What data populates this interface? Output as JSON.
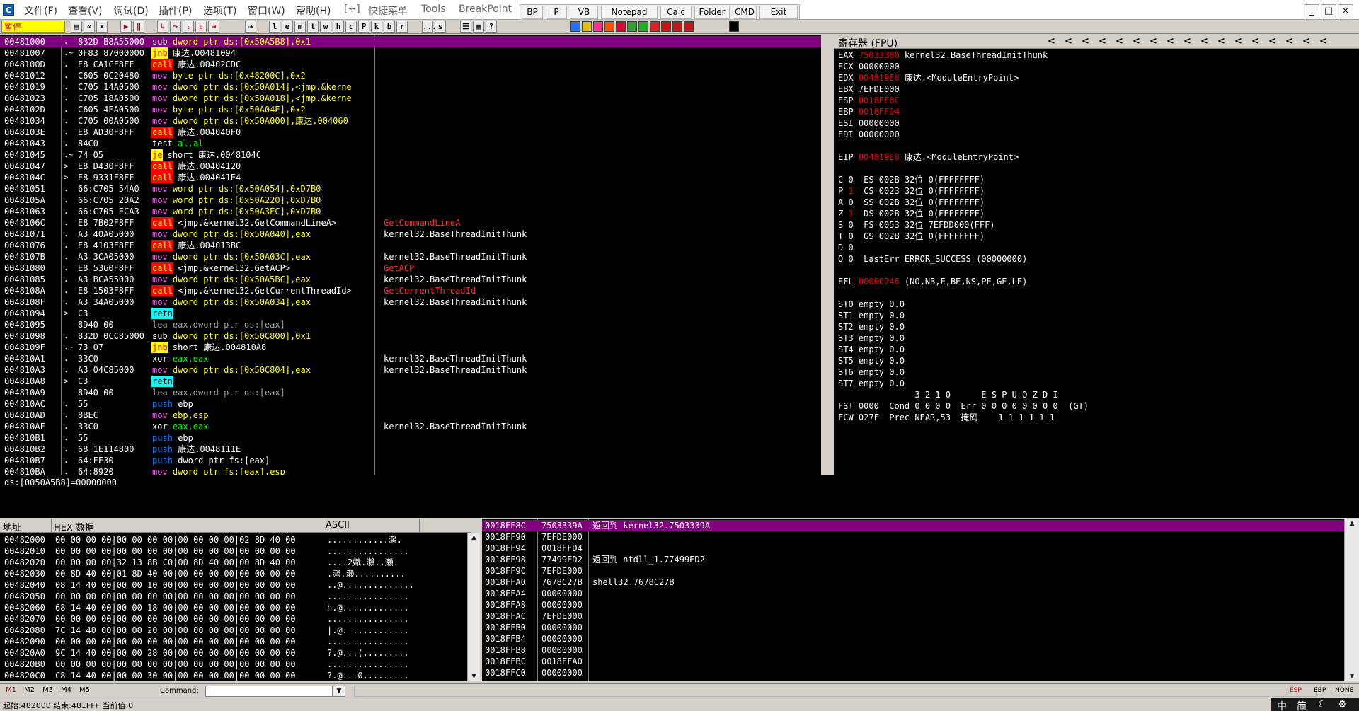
{
  "colors": {
    "accent_purple": "#800080",
    "call_red": "#ff0000",
    "jump_yellow": "#ffff00",
    "retn_cyan": "#00ffff",
    "reg_changed_red": "#ff0000",
    "comment_red": "#ff3030"
  },
  "menubar": {
    "items": [
      "文件(F)",
      "查看(V)",
      "调试(D)",
      "插件(P)",
      "选项(T)",
      "窗口(W)",
      "帮助(H)",
      "[+]",
      "快捷菜单",
      "Tools",
      "BreakPoint"
    ],
    "plugin_buttons": [
      "BP",
      "P",
      "VB",
      "Notepad",
      "Calc",
      "Folder",
      "CMD",
      "Exit"
    ],
    "window_controls": [
      "_",
      "□",
      "×"
    ]
  },
  "toolbar": {
    "status": "暂停",
    "buttons": [
      "l",
      "e",
      "m",
      "t",
      "w",
      "h",
      "c",
      "P",
      "k",
      "b",
      "r",
      "...",
      "s"
    ],
    "icons": [
      "open-icon",
      "rewind-icon",
      "close-icon",
      "run-icon",
      "pause-icon",
      "step-into-icon",
      "step-over-icon",
      "trace-into-icon",
      "trace-over-icon",
      "execute-till-return-icon",
      "goto-icon"
    ]
  },
  "disasm": {
    "rows": [
      {
        "addr": "00481000",
        "m": ".",
        "hex": "832D B8A55000",
        "mn": "sub",
        "ops": "dword ptr ds:[0x50A5B8],0x1",
        "cmt": "",
        "sel": true
      },
      {
        "addr": "00481007",
        "m": ".~",
        "hex": "0F83 87000000",
        "mn": "jnb",
        "ops": "康达.00481094",
        "cmt": ""
      },
      {
        "addr": "0048100D",
        "m": ".",
        "hex": "E8 CA1CF8FF",
        "mn": "call",
        "ops": "康达.00402CDC",
        "cmt": ""
      },
      {
        "addr": "00481012",
        "m": ".",
        "hex": "C605 0C20480",
        "mn": "mov",
        "ops": "byte ptr ds:[0x48200C],0x2",
        "cmt": ""
      },
      {
        "addr": "00481019",
        "m": ".",
        "hex": "C705 14A0500",
        "mn": "mov",
        "ops": "dword ptr ds:[0x50A014],<jmp.&kerne",
        "cmt": ""
      },
      {
        "addr": "00481023",
        "m": ".",
        "hex": "C705 18A0500",
        "mn": "mov",
        "ops": "dword ptr ds:[0x50A018],<jmp.&kerne",
        "cmt": ""
      },
      {
        "addr": "0048102D",
        "m": ".",
        "hex": "C605 4EA0500",
        "mn": "mov",
        "ops": "byte ptr ds:[0x50A04E],0x2",
        "cmt": ""
      },
      {
        "addr": "00481034",
        "m": ".",
        "hex": "C705 00A0500",
        "mn": "mov",
        "ops": "dword ptr ds:[0x50A000],康达.004060",
        "cmt": ""
      },
      {
        "addr": "0048103E",
        "m": ".",
        "hex": "E8 AD30F8FF",
        "mn": "call",
        "ops": "康达.004040F0",
        "cmt": ""
      },
      {
        "addr": "00481043",
        "m": ".",
        "hex": "84C0",
        "mn": "test",
        "ops": "al,al",
        "cmt": ""
      },
      {
        "addr": "00481045",
        "m": ".~",
        "hex": "74 05",
        "mn": "je",
        "ops": "short 康达.0048104C",
        "cmt": ""
      },
      {
        "addr": "00481047",
        "m": ">",
        "hex": "E8 D430F8FF",
        "mn": "call",
        "ops": "康达.00404120",
        "cmt": ""
      },
      {
        "addr": "0048104C",
        "m": ">",
        "hex": "E8 9331F8FF",
        "mn": "call",
        "ops": "康达.004041E4",
        "cmt": ""
      },
      {
        "addr": "00481051",
        "m": ".",
        "hex": "66:C705 54A0",
        "mn": "mov",
        "ops": "word ptr ds:[0x50A054],0xD7B0",
        "cmt": ""
      },
      {
        "addr": "0048105A",
        "m": ".",
        "hex": "66:C705 20A2",
        "mn": "mov",
        "ops": "word ptr ds:[0x50A220],0xD7B0",
        "cmt": ""
      },
      {
        "addr": "00481063",
        "m": ".",
        "hex": "66:C705 ECA3",
        "mn": "mov",
        "ops": "word ptr ds:[0x50A3EC],0xD7B0",
        "cmt": ""
      },
      {
        "addr": "0048106C",
        "m": ".",
        "hex": "E8 7B02F8FF",
        "mn": "call",
        "ops": "<jmp.&kernel32.GetCommandLineA>",
        "cmt": "GetCommandLineA",
        "cr": true
      },
      {
        "addr": "00481071",
        "m": ".",
        "hex": "A3 40A05000",
        "mn": "mov",
        "ops": "dword ptr ds:[0x50A040],eax",
        "cmt": "kernel32.BaseThreadInitThunk"
      },
      {
        "addr": "00481076",
        "m": ".",
        "hex": "E8 4103F8FF",
        "mn": "call",
        "ops": "康达.004013BC",
        "cmt": ""
      },
      {
        "addr": "0048107B",
        "m": ".",
        "hex": "A3 3CA05000",
        "mn": "mov",
        "ops": "dword ptr ds:[0x50A03C],eax",
        "cmt": "kernel32.BaseThreadInitThunk"
      },
      {
        "addr": "00481080",
        "m": ".",
        "hex": "E8 5360F8FF",
        "mn": "call",
        "ops": "<jmp.&kernel32.GetACP>",
        "cmt": "GetACP",
        "cr": true
      },
      {
        "addr": "00481085",
        "m": ".",
        "hex": "A3 BCA55000",
        "mn": "mov",
        "ops": "dword ptr ds:[0x50A5BC],eax",
        "cmt": "kernel32.BaseThreadInitThunk"
      },
      {
        "addr": "0048108A",
        "m": ".",
        "hex": "E8 1503F8FF",
        "mn": "call",
        "ops": "<jmp.&kernel32.GetCurrentThreadId>",
        "cmt": "GetCurrentThreadId",
        "cr": true
      },
      {
        "addr": "0048108F",
        "m": ".",
        "hex": "A3 34A05000",
        "mn": "mov",
        "ops": "dword ptr ds:[0x50A034],eax",
        "cmt": "kernel32.BaseThreadInitThunk"
      },
      {
        "addr": "00481094",
        "m": ">",
        "hex": "C3",
        "mn": "retn",
        "ops": "",
        "cmt": ""
      },
      {
        "addr": "00481095",
        "m": "",
        "hex": "8D40 00",
        "mn": "lea",
        "ops": "eax,dword ptr ds:[eax]",
        "cmt": "",
        "g": true
      },
      {
        "addr": "00481098",
        "m": ".",
        "hex": "832D 0CC85000",
        "mn": "sub",
        "ops": "dword ptr ds:[0x50C800],0x1",
        "cmt": ""
      },
      {
        "addr": "0048109F",
        "m": ".~",
        "hex": "73 07",
        "mn": "jnb",
        "ops": "short 康达.004810A8",
        "cmt": ""
      },
      {
        "addr": "004810A1",
        "m": ".",
        "hex": "33C0",
        "mn": "xor",
        "ops": "eax,eax",
        "cmt": "kernel32.BaseThreadInitThunk"
      },
      {
        "addr": "004810A3",
        "m": ".",
        "hex": "A3 04C85000",
        "mn": "mov",
        "ops": "dword ptr ds:[0x50C804],eax",
        "cmt": "kernel32.BaseThreadInitThunk"
      },
      {
        "addr": "004810A8",
        "m": ">",
        "hex": "C3",
        "mn": "retn",
        "ops": "",
        "cmt": ""
      },
      {
        "addr": "004810A9",
        "m": "",
        "hex": "8D40 00",
        "mn": "lea",
        "ops": "eax,dword ptr ds:[eax]",
        "cmt": "",
        "g": true
      },
      {
        "addr": "004810AC",
        "m": ".",
        "hex": "55",
        "mn": "push",
        "ops": "ebp",
        "cmt": ""
      },
      {
        "addr": "004810AD",
        "m": ".",
        "hex": "8BEC",
        "mn": "mov",
        "ops": "ebp,esp",
        "cmt": ""
      },
      {
        "addr": "004810AF",
        "m": ".",
        "hex": "33C0",
        "mn": "xor",
        "ops": "eax,eax",
        "cmt": "kernel32.BaseThreadInitThunk"
      },
      {
        "addr": "004810B1",
        "m": ".",
        "hex": "55",
        "mn": "push",
        "ops": "ebp",
        "cmt": ""
      },
      {
        "addr": "004810B2",
        "m": ".",
        "hex": "68 1E114800",
        "mn": "push",
        "ops": "康达.0048111E",
        "cmt": ""
      },
      {
        "addr": "004810B7",
        "m": ".",
        "hex": "64:FF30",
        "mn": "push",
        "ops": "dword ptr fs:[eax]",
        "cmt": ""
      },
      {
        "addr": "004810BA",
        "m": ".",
        "hex": "64:8920",
        "mn": "mov",
        "ops": "dword ptr fs:[eax],esp",
        "cmt": ""
      }
    ]
  },
  "info_line": "ds:[0050A5B8]=00000000",
  "registers": {
    "title": "寄存器 (FPU)",
    "nav": [
      "<",
      "<",
      "<",
      "<",
      "<",
      "<",
      "<",
      "<",
      "<",
      "<",
      "<",
      "<",
      "<",
      "<",
      "<",
      "<",
      "<"
    ],
    "lines": [
      {
        "t": "EAX ",
        "v": "75033380",
        "c": true,
        "r": " kernel32.BaseThreadInitThunk"
      },
      {
        "t": "ECX ",
        "v": "00000000",
        "c": false,
        "r": ""
      },
      {
        "t": "EDX ",
        "v": "004819E8",
        "c": true,
        "r": " 康达.<ModuleEntryPoint>"
      },
      {
        "t": "EBX ",
        "v": "7EFDE000",
        "c": false,
        "r": ""
      },
      {
        "t": "ESP ",
        "v": "0018FF8C",
        "c": true,
        "r": ""
      },
      {
        "t": "EBP ",
        "v": "0018FF94",
        "c": true,
        "r": ""
      },
      {
        "t": "ESI ",
        "v": "00000000",
        "c": false,
        "r": ""
      },
      {
        "t": "EDI ",
        "v": "00000000",
        "c": false,
        "r": ""
      },
      {
        "t": "",
        "v": "",
        "c": false,
        "r": ""
      },
      {
        "t": "EIP ",
        "v": "004819E8",
        "c": true,
        "r": " 康达.<ModuleEntryPoint>"
      },
      {
        "t": "",
        "v": "",
        "c": false,
        "r": ""
      },
      {
        "t": "C 0  ES 002B 32位 0(FFFFFFFF)",
        "v": "",
        "c": false,
        "r": ""
      },
      {
        "t": "P ",
        "v": "1",
        "c": true,
        "r": "  CS 0023 32位 0(FFFFFFFF)"
      },
      {
        "t": "A 0  SS 002B 32位 0(FFFFFFFF)",
        "v": "",
        "c": false,
        "r": ""
      },
      {
        "t": "Z ",
        "v": "1",
        "c": true,
        "r": "  DS 002B 32位 0(FFFFFFFF)"
      },
      {
        "t": "S 0  FS 0053 32位 7EFDD000(FFF)",
        "v": "",
        "c": false,
        "r": ""
      },
      {
        "t": "T 0  GS 002B 32位 0(FFFFFFFF)",
        "v": "",
        "c": false,
        "r": ""
      },
      {
        "t": "D 0",
        "v": "",
        "c": false,
        "r": ""
      },
      {
        "t": "O 0  LastErr ERROR_SUCCESS (00000000)",
        "v": "",
        "c": false,
        "r": ""
      },
      {
        "t": "",
        "v": "",
        "c": false,
        "r": ""
      },
      {
        "t": "EFL ",
        "v": "00000246",
        "c": true,
        "r": " (NO,NB,E,BE,NS,PE,GE,LE)"
      },
      {
        "t": "",
        "v": "",
        "c": false,
        "r": ""
      },
      {
        "t": "ST0 empty 0.0",
        "v": "",
        "c": false,
        "r": ""
      },
      {
        "t": "ST1 empty 0.0",
        "v": "",
        "c": false,
        "r": ""
      },
      {
        "t": "ST2 empty 0.0",
        "v": "",
        "c": false,
        "r": ""
      },
      {
        "t": "ST3 empty 0.0",
        "v": "",
        "c": false,
        "r": ""
      },
      {
        "t": "ST4 empty 0.0",
        "v": "",
        "c": false,
        "r": ""
      },
      {
        "t": "ST5 empty 0.0",
        "v": "",
        "c": false,
        "r": ""
      },
      {
        "t": "ST6 empty 0.0",
        "v": "",
        "c": false,
        "r": ""
      },
      {
        "t": "ST7 empty 0.0",
        "v": "",
        "c": false,
        "r": ""
      },
      {
        "t": "               3 2 1 0      E S P U O Z D I",
        "v": "",
        "c": false,
        "r": ""
      },
      {
        "t": "FST 0000  Cond 0 0 0 0  Err 0 0 0 0 0 0 0 0  (GT)",
        "v": "",
        "c": false,
        "r": ""
      },
      {
        "t": "FCW 027F  Prec NEAR,53  掩码    1 1 1 1 1 1",
        "v": "",
        "c": false,
        "r": ""
      }
    ]
  },
  "dump": {
    "col_addr": "地址",
    "col_hex": "HEX 数据",
    "col_ascii": "ASCII",
    "rows": [
      {
        "addr": "00482000",
        "hex": "00 00 00 00|00 00 00 00|00 00 00 00|02 8D 40 00",
        "asc": "............瀨."
      },
      {
        "addr": "00482010",
        "hex": "00 00 00 00|00 00 00 00|00 00 00 00|00 00 00 00",
        "asc": "................"
      },
      {
        "addr": "00482020",
        "hex": "00 00 00 00|32 13 8B C0|00 8D 40 00|00 8D 40 00",
        "asc": "....2嬂.瀨..瀨."
      },
      {
        "addr": "00482030",
        "hex": "00 8D 40 00|01 8D 40 00|00 00 00 00|00 00 00 00",
        "asc": ".瀨.瀨.........."
      },
      {
        "addr": "00482040",
        "hex": "08 14 40 00|00 00 10 00|00 00 00 00|00 00 00 00",
        "asc": "..@.............."
      },
      {
        "addr": "00482050",
        "hex": "00 00 00 00|00 00 00 00|00 00 00 00|00 00 00 00",
        "asc": "................"
      },
      {
        "addr": "00482060",
        "hex": "68 14 40 00|00 00 18 00|00 00 00 00|00 00 00 00",
        "asc": "h.@............."
      },
      {
        "addr": "00482070",
        "hex": "00 00 00 00|00 00 00 00|00 00 00 00|00 00 00 00",
        "asc": "................"
      },
      {
        "addr": "00482080",
        "hex": "7C 14 40 00|00 00 20 00|00 00 00 00|00 00 00 00",
        "asc": "|.@. ..........."
      },
      {
        "addr": "00482090",
        "hex": "00 00 00 00|00 00 00 00|00 00 00 00|00 00 00 00",
        "asc": "................"
      },
      {
        "addr": "004820A0",
        "hex": "9C 14 40 00|00 00 28 00|00 00 00 00|00 00 00 00",
        "asc": "?.@...(........."
      },
      {
        "addr": "004820B0",
        "hex": "00 00 00 00|00 00 00 00|00 00 00 00|00 00 00 00",
        "asc": "................"
      },
      {
        "addr": "004820C0",
        "hex": "C8 14 40 00|00 00 30 00|00 00 00 00|00 00 00 00",
        "asc": "?.@...0........."
      }
    ]
  },
  "stack": {
    "rows": [
      {
        "addr": "0018FF8C",
        "val": "7503339A",
        "cmt": "返回到 kernel32.7503339A",
        "sel": true
      },
      {
        "addr": "0018FF90",
        "val": "7EFDE000",
        "cmt": ""
      },
      {
        "addr": "0018FF94",
        "val": "0018FFD4",
        "cmt": ""
      },
      {
        "addr": "0018FF98",
        "val": "77499ED2",
        "cmt": "返回到 ntdll_1.77499ED2"
      },
      {
        "addr": "0018FF9C",
        "val": "7EFDE000",
        "cmt": ""
      },
      {
        "addr": "0018FFA0",
        "val": "7678C27B",
        "cmt": "shell32.7678C27B"
      },
      {
        "addr": "0018FFA4",
        "val": "00000000",
        "cmt": ""
      },
      {
        "addr": "0018FFA8",
        "val": "00000000",
        "cmt": ""
      },
      {
        "addr": "0018FFAC",
        "val": "7EFDE000",
        "cmt": ""
      },
      {
        "addr": "0018FFB0",
        "val": "00000000",
        "cmt": ""
      },
      {
        "addr": "0018FFB4",
        "val": "00000000",
        "cmt": ""
      },
      {
        "addr": "0018FFB8",
        "val": "00000000",
        "cmt": ""
      },
      {
        "addr": "0018FFBC",
        "val": "0018FFA0",
        "cmt": ""
      },
      {
        "addr": "0018FFC0",
        "val": "00000000",
        "cmt": ""
      }
    ]
  },
  "cmdbar": {
    "marks": [
      "M1",
      "M2",
      "M3",
      "M4",
      "M5"
    ],
    "command_label": "Command:",
    "command_value": "",
    "right_tags": [
      "ESP",
      "EBP",
      "NONE"
    ]
  },
  "statusbar": {
    "text": "起始:482000 结束:481FFF 当前值:0",
    "ime": [
      "中",
      "简",
      "☾",
      "⚙"
    ]
  }
}
